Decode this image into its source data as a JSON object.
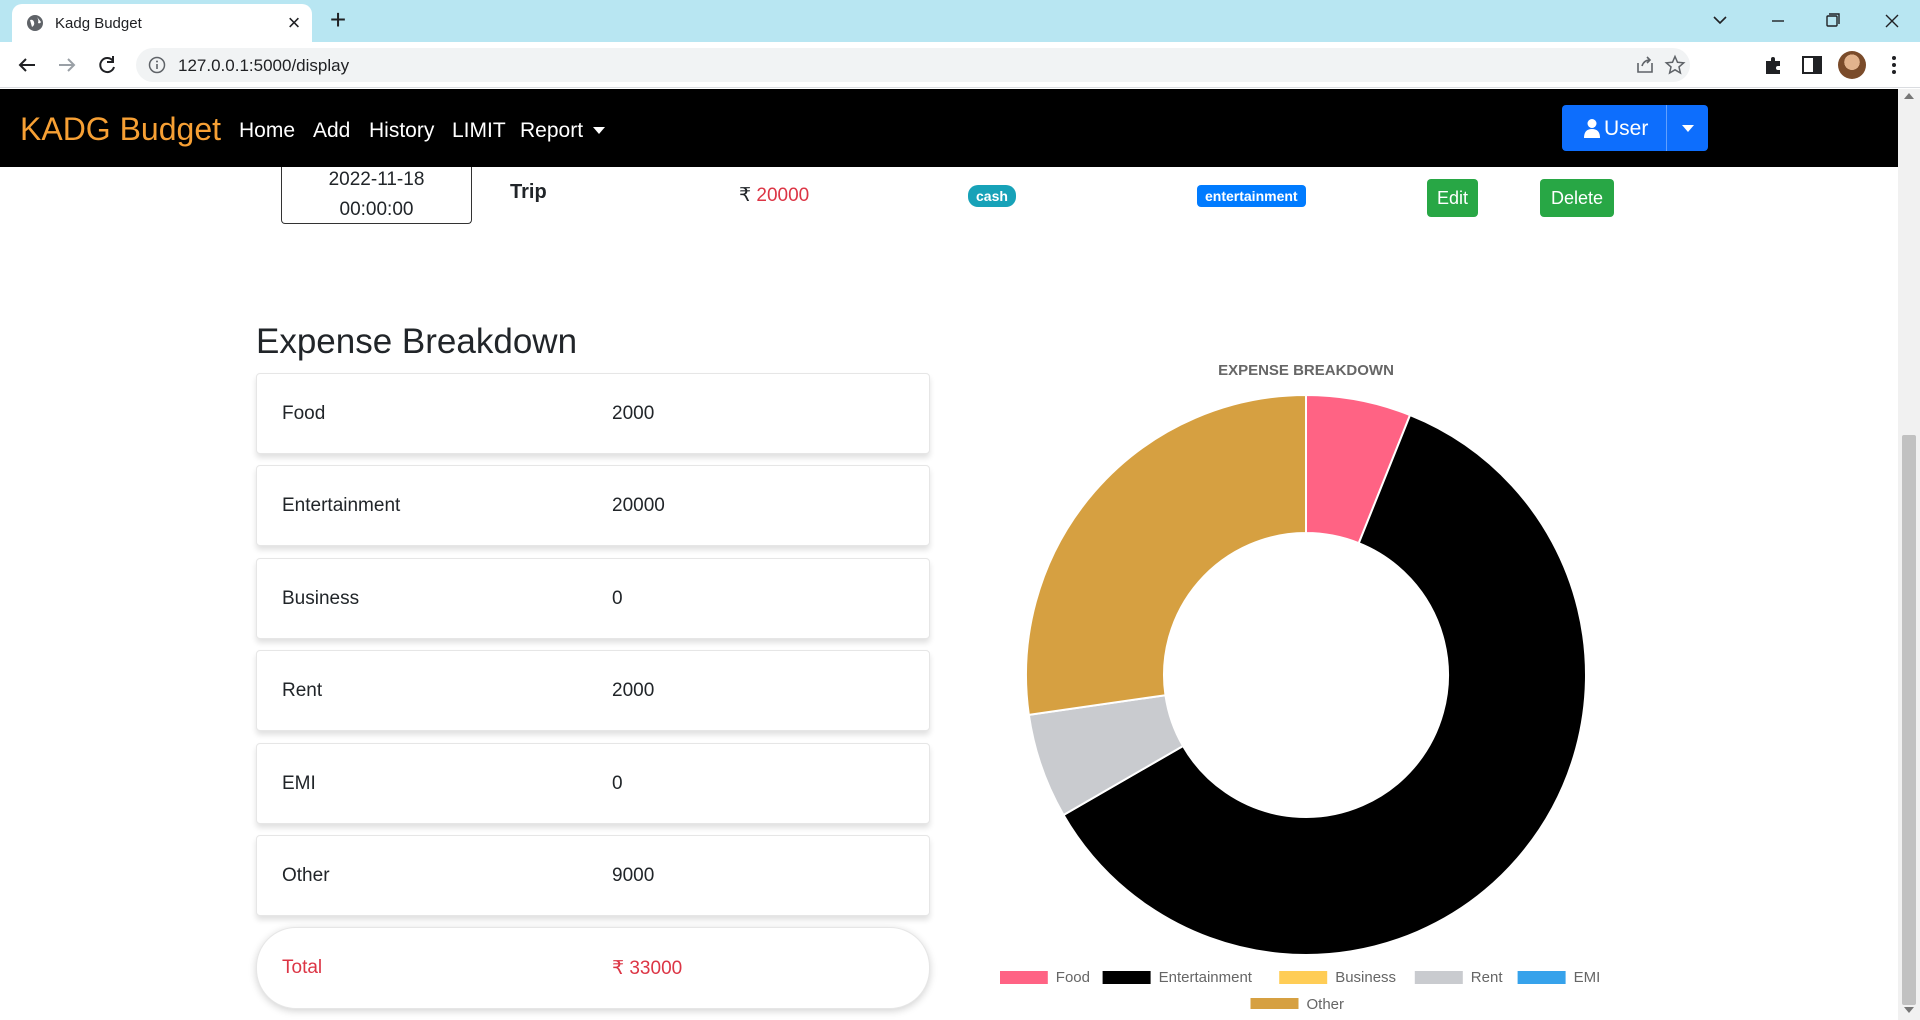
{
  "browser": {
    "tab_title": "Kadg Budget",
    "url": "127.0.0.1:5000/display"
  },
  "navbar": {
    "brand": "KADG Budget",
    "links": [
      "Home",
      "Add",
      "History",
      "LIMIT",
      "Report"
    ],
    "user_label": "User"
  },
  "transaction": {
    "date": "2022-11-18",
    "time": "00:00:00",
    "name": "Trip",
    "currency": "₹",
    "amount": "20000",
    "payment_mode": "cash",
    "category": "entertainment",
    "edit_label": "Edit",
    "delete_label": "Delete"
  },
  "breakdown": {
    "title": "Expense Breakdown",
    "items": [
      {
        "label": "Food",
        "value": "2000"
      },
      {
        "label": "Entertainment",
        "value": "20000"
      },
      {
        "label": "Business",
        "value": "0"
      },
      {
        "label": "Rent",
        "value": "2000"
      },
      {
        "label": "EMI",
        "value": "0"
      },
      {
        "label": "Other",
        "value": "9000"
      }
    ],
    "total_label": "Total",
    "total_value": "₹ 33000"
  },
  "colors": {
    "brand": "#f7a034",
    "navbar_bg": "#000000",
    "primary": "#0d6efd",
    "success": "#28a745",
    "danger": "#dc3545",
    "info": "#17a2b8"
  },
  "chart_data": {
    "type": "pie",
    "title": "EXPENSE BREAKDOWN",
    "donut": true,
    "legend_position": "bottom",
    "categories": [
      "Food",
      "Entertainment",
      "Business",
      "Rent",
      "EMI",
      "Other"
    ],
    "values": [
      2000,
      20000,
      0,
      2000,
      0,
      9000
    ],
    "colors": [
      "#ff6384",
      "#000000",
      "#ffcd56",
      "#c9cbcf",
      "#36a2eb",
      "#d6a041"
    ]
  }
}
